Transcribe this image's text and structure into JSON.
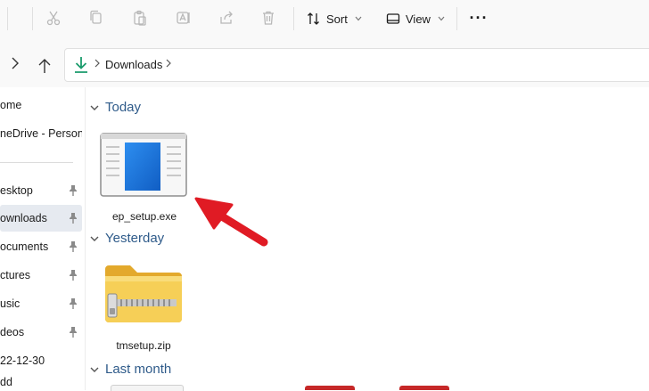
{
  "toolbar": {
    "sort_label": "Sort",
    "view_label": "View",
    "more_label": "···"
  },
  "address": {
    "location": "Downloads"
  },
  "sidebar": {
    "items": [
      {
        "label": "ome"
      },
      {
        "label": "neDrive - Persona"
      },
      {
        "label": "esktop"
      },
      {
        "label": "ownloads"
      },
      {
        "label": "ocuments"
      },
      {
        "label": "ctures"
      },
      {
        "label": "usic"
      },
      {
        "label": "deos"
      },
      {
        "label": "22-12-30"
      },
      {
        "label": "dd"
      }
    ]
  },
  "content": {
    "groups": [
      {
        "label": "Today",
        "files": [
          {
            "name": "ep_setup.exe"
          }
        ]
      },
      {
        "label": "Yesterday",
        "files": [
          {
            "name": "tmsetup.zip"
          }
        ]
      },
      {
        "label": "Last month"
      }
    ]
  },
  "colors": {
    "accent": "#2f5b8a",
    "arrow": "#e01b24",
    "folder": "#f2c94c"
  }
}
